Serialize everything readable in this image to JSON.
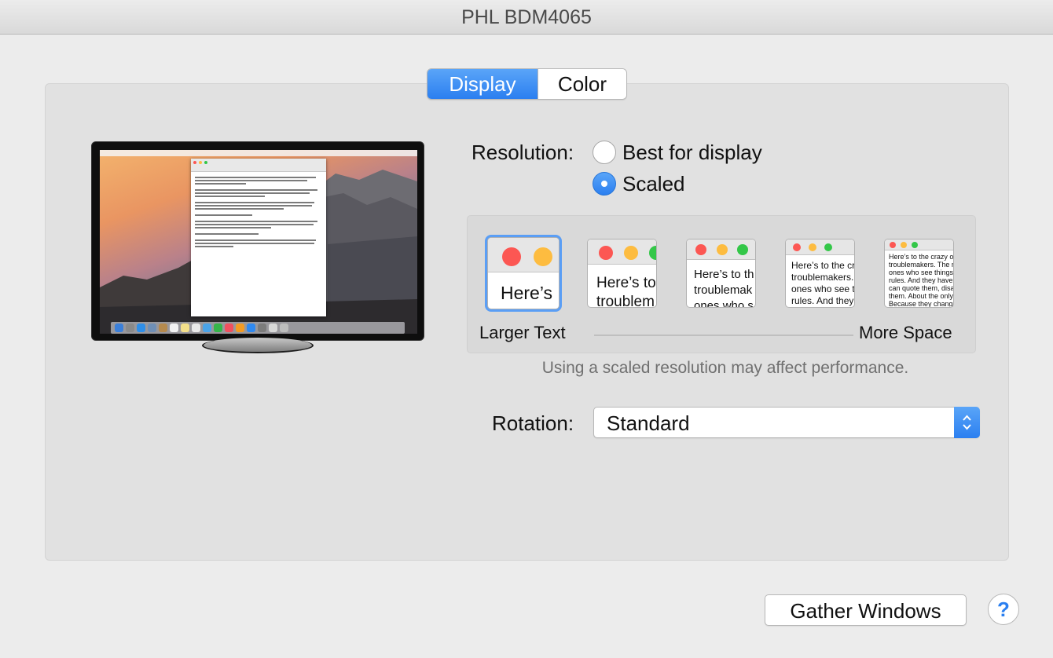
{
  "window": {
    "title": "PHL BDM4065"
  },
  "tabs": [
    {
      "label": "Display",
      "active": true
    },
    {
      "label": "Color",
      "active": false
    }
  ],
  "resolution": {
    "label": "Resolution:",
    "options": [
      {
        "label": "Best for display",
        "selected": false
      },
      {
        "label": "Scaled",
        "selected": true
      }
    ]
  },
  "scaling": {
    "left_label": "Larger Text",
    "right_label": "More Space",
    "selected_index": 0,
    "previews": [
      {
        "text": "Here’s"
      },
      {
        "text": "Here’s to\ntroublem"
      },
      {
        "text": "Here’s to th\ntroublemak\nones who s"
      },
      {
        "text": "Here’s to the cr\ntroublemakers.\nones who see t\nrules. And they"
      },
      {
        "text": "Here’s to the crazy one\ntroublemakers. The round\nones who see things di\nrules. And they have no\ncan quote them, disagre\nthem. About the only th\nBecause they change th"
      }
    ],
    "note": "Using a scaled resolution may affect performance."
  },
  "rotation": {
    "label": "Rotation:",
    "value": "Standard"
  },
  "footer": {
    "gather_label": "Gather Windows",
    "help_label": "?"
  },
  "colors": {
    "accent": "#2b7ff0",
    "close": "#fc5753",
    "minimize": "#fdbc40",
    "zoom": "#33c748"
  }
}
